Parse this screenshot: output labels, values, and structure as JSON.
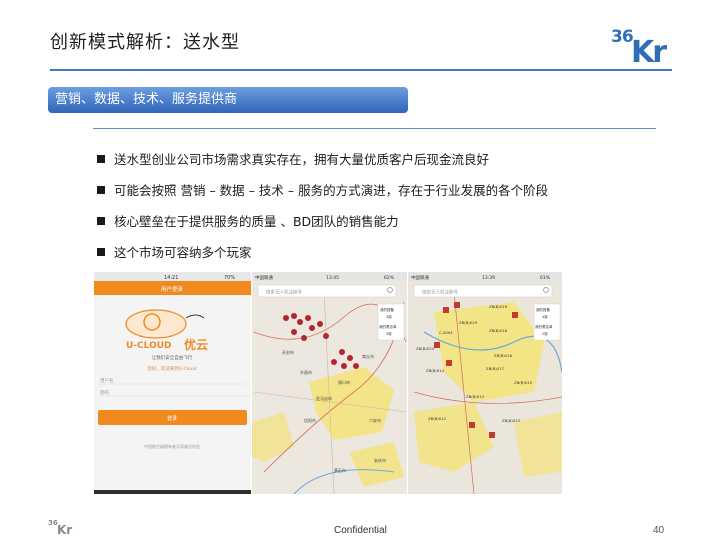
{
  "slide": {
    "title": "创新模式解析：送水型",
    "logo_text": "36Kr",
    "banner": "营销、数据、技术、服务提供商",
    "bullets": [
      "送水型创业公司市场需求真实存在，拥有大量优质客户后现金流良好",
      "可能会按照 营销 – 数据 – 技术 – 服务的方式演进，存在于行业发展的各个阶段",
      "核心壁垒在于提供服务的质量 、BD团队的销售能力",
      "这个市场可容纳多个玩家"
    ],
    "footer": {
      "confidential": "Confidential",
      "page_number": "40"
    }
  },
  "screenshots": {
    "app": {
      "time": "14:21",
      "battery": "70%",
      "header": "用户登录",
      "logo_text": "U-CLOUD",
      "logo_cn": "优云",
      "slogan": "让我们安全自由飞行",
      "welcome": "您好，欢迎来到U-Cloud",
      "username_placeholder": "用户名",
      "password_placeholder": "密码",
      "login_label": "登录",
      "footer_note": "中国航空器拥有者及驾驶员协会"
    },
    "map1": {
      "carrier": "中国联通",
      "time": "13:45",
      "battery": "62%",
      "search_placeholder": "搜索无人机注册号",
      "panel": [
        "我的报备",
        "4架",
        "我的黑名单",
        "3架"
      ],
      "labels": [
        "开封市",
        "周口市",
        "六安市",
        "信阳市",
        "驻马店市",
        "商丘市",
        "许昌市",
        "安庆市",
        "黄石市"
      ]
    },
    "map2": {
      "carrier": "中国联通",
      "time": "13:39",
      "battery": "61%",
      "search_placeholder": "搜索无人机注册号",
      "panel": [
        "我的报备",
        "4架",
        "我的黑名单",
        "2架"
      ],
      "labels": [
        "ZB(B)029",
        "ZB(B)019",
        "ZB(B)018",
        "ZB(B)016",
        "C-0004",
        "ZB(B)024",
        "ZB(B)014",
        "ZB(B)017",
        "ZB(B)015",
        "ZB(B)013",
        "ZB(B)012",
        "ZB(B)023"
      ]
    }
  }
}
